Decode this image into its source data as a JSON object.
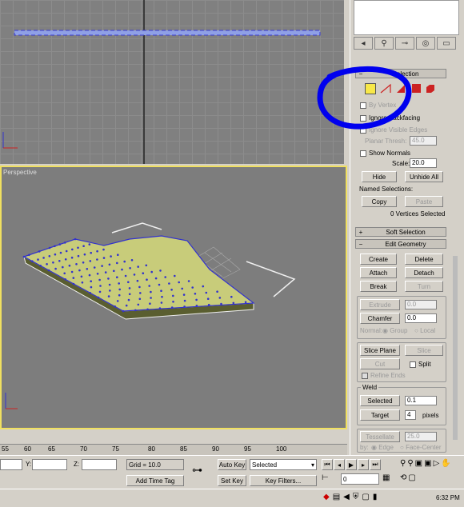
{
  "viewports": {
    "perspective_label": "Perspective"
  },
  "panel": {
    "selection_header": "Selection",
    "by_vertex": "By Vertex",
    "ignore_backfacing": "Ignore Backfacing",
    "ignore_visible_edges": "Ignore Visible Edges",
    "planar_thresh_label": "Planar Thresh:",
    "planar_thresh_value": "45.0",
    "show_normals": "Show Normals",
    "scale_label": "Scale:",
    "scale_value": "20.0",
    "hide": "Hide",
    "unhide_all": "Unhide All",
    "named_selections": "Named Selections:",
    "copy": "Copy",
    "paste": "Paste",
    "vertices_selected": "0 Vertices Selected",
    "soft_selection": "Soft Selection",
    "edit_geometry": "Edit Geometry",
    "create": "Create",
    "delete": "Delete",
    "attach": "Attach",
    "detach": "Detach",
    "break": "Break",
    "turn": "Turn",
    "extrude": "Extrude",
    "extrude_value": "0.0",
    "chamfer": "Chamfer",
    "chamfer_value": "0.0",
    "normal": "Normal:",
    "group": "Group",
    "local": "Local",
    "slice_plane": "Slice Plane",
    "slice": "Slice",
    "cut": "Cut",
    "split": "Split",
    "refine_ends": "Refine Ends",
    "weld": "Weld",
    "selected": "Selected",
    "selected_value": "0.1",
    "target": "Target",
    "target_value": "4",
    "pixels": "pixels",
    "tessellate": "Tessellate",
    "tessellate_value": "25.0",
    "by": "by:",
    "edge": "Edge",
    "face_center": "Face-Center"
  },
  "timeline": {
    "ticks": [
      "55",
      "60",
      "65",
      "70",
      "75",
      "80",
      "85",
      "90",
      "95",
      "100"
    ]
  },
  "status": {
    "y_label": "Y:",
    "z_label": "Z:",
    "grid": "Grid = 10.0",
    "add_time_tag": "Add Time Tag",
    "auto_key": "Auto Key",
    "set_key": "Set Key",
    "selected_dropdown": "Selected",
    "key_filters": "Key Filters...",
    "frame": "0"
  },
  "taskbar": {
    "clock": "6:32 PM"
  },
  "annotation": {
    "color": "#0000ee"
  },
  "colors": {
    "mesh": "#c8cc7a",
    "vertex": "#3333cc",
    "active_border": "#f0e060"
  }
}
